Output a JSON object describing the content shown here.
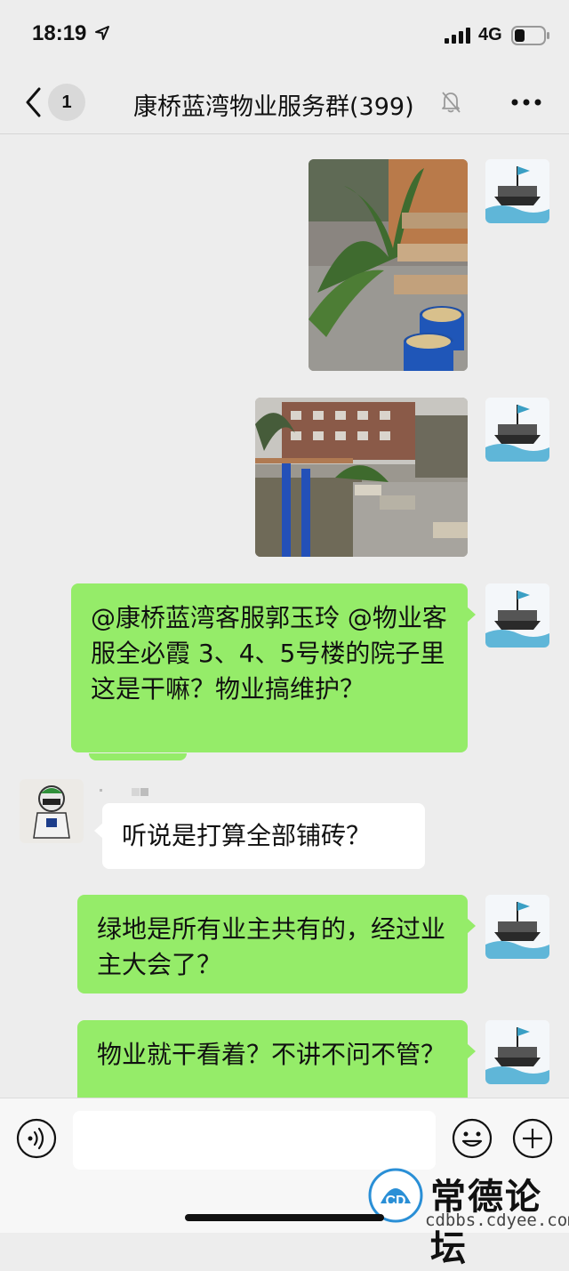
{
  "status": {
    "time": "18:19",
    "network": "4G"
  },
  "nav": {
    "unread": "1",
    "title": "康桥蓝湾物业服务群(399)"
  },
  "messages": [
    {
      "type": "image",
      "from": "self",
      "subject": "cycad plants, lumber planks and buckets of sand"
    },
    {
      "type": "image",
      "from": "self",
      "subject": "courtyard with exercise bars, building and sand bags"
    },
    {
      "type": "text",
      "from": "self",
      "text": "@康桥蓝湾客服郭玉玲 @物业客服全必霞 3、4、5号楼的院子里这是干嘛？物业搞维护？"
    },
    {
      "type": "text",
      "from": "other",
      "text": "听说是打算全部铺砖？"
    },
    {
      "type": "text",
      "from": "self",
      "text": "绿地是所有业主共有的，经过业主大会了？"
    },
    {
      "type": "text",
      "from": "self",
      "text": "物业就干看着？不讲不问不管？"
    }
  ],
  "watermark": {
    "name": "常德论坛",
    "url": "cdbbs.cdyee.com",
    "logo_text": "常德论坛"
  },
  "colors": {
    "background": "#ededed",
    "self_bubble": "#95ec69",
    "other_bubble": "#ffffff"
  },
  "icons": [
    "location-arrow-icon",
    "signal-icon",
    "battery-icon",
    "back-chevron-icon",
    "mute-bell-icon",
    "more-dots-icon",
    "voice-icon",
    "emoji-icon",
    "add-icon"
  ]
}
